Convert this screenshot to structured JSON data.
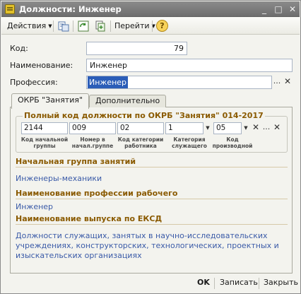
{
  "window": {
    "title": "Должности: Инженер",
    "controls": {
      "minimize": "_",
      "maximize": "□",
      "close": "✕"
    }
  },
  "toolbar": {
    "actions_label": "Действия",
    "goto_label": "Перейти",
    "help_label": "?"
  },
  "form": {
    "code_label": "Код:",
    "code_value": "79",
    "name_label": "Наименование:",
    "name_value": "Инженер",
    "profession_label": "Профессия:",
    "profession_value": "Инженер"
  },
  "tabs": [
    {
      "label": "ОКРБ \"Занятия\"",
      "active": true
    },
    {
      "label": "Дополнительно",
      "active": false
    }
  ],
  "okrb": {
    "group_title": "Полный код должности по ОКРБ \"Занятия\" 014-2017",
    "fields": [
      {
        "value": "2144",
        "label": "Код начальной группы"
      },
      {
        "value": "009",
        "label": "Номер в начал.группе"
      },
      {
        "value": "02",
        "label": "Код категории работника"
      },
      {
        "value": "1",
        "label": "Категория служащего"
      },
      {
        "value": "05",
        "label": "Код производной"
      }
    ],
    "initial_group_title": "Начальная группа занятий",
    "initial_group_value": "Инженеры-механики",
    "worker_profession_title": "Наименование профессии рабочего",
    "worker_profession_value": "Инженер",
    "eksd_title": "Наименование выпуска по ЕКСД",
    "eksd_value": "Должности служащих, занятых в научно-исследовательских учреждениях, конструкторских, технологических, проектных и изыскательских организациях"
  },
  "bottom": {
    "ok_label": "OK",
    "save_label": "Записать",
    "close_label": "Закрыть"
  },
  "colors": {
    "section_title": "#8a5a00",
    "link": "#3b5ba8",
    "selection": "#2b5db8"
  }
}
